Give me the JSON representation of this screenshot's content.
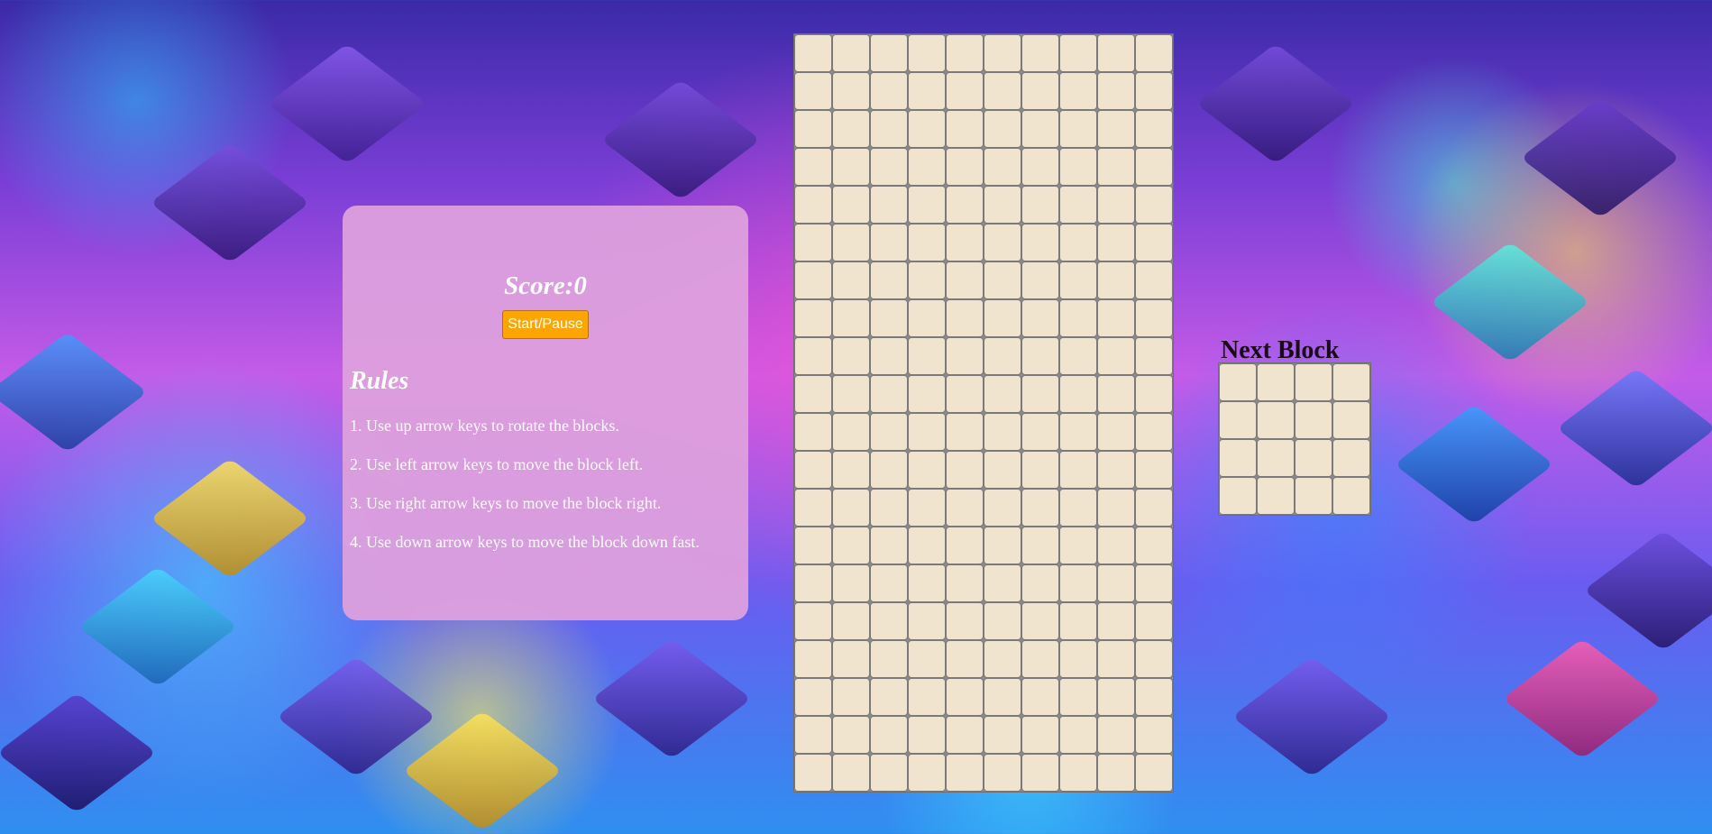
{
  "scoreboard": {
    "score_text": "Score:0",
    "start_pause_label": "Start/Pause"
  },
  "rules": {
    "title": "Rules",
    "items": [
      "1. Use up arrow keys to rotate the blocks.",
      "2. Use left arrow keys to move the block left.",
      "3. Use right arrow keys to move the block right.",
      "4. Use down arrow keys to move the block down fast."
    ]
  },
  "board": {
    "columns": 10,
    "rows": 20
  },
  "next_block": {
    "title": "Next Block",
    "columns": 4,
    "rows": 4
  },
  "colors": {
    "panel": "#dda0dd",
    "button": "#ffa500",
    "empty_cell": "#f1e4cf"
  }
}
